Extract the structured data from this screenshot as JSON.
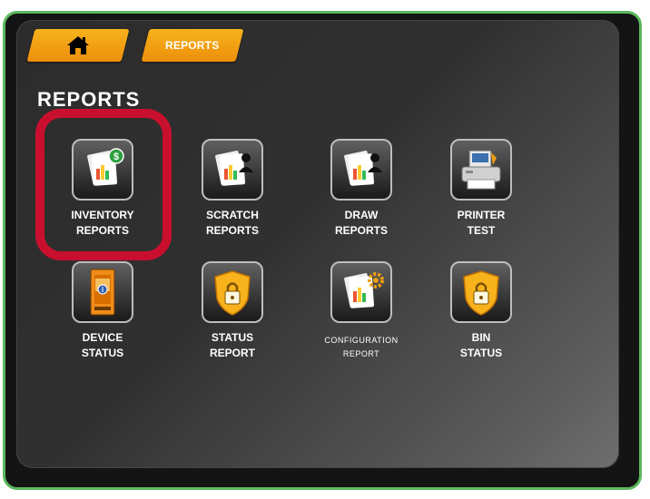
{
  "breadcrumb": {
    "home_icon": "home-icon",
    "current": "REPORTS"
  },
  "page": {
    "title": "REPORTS"
  },
  "tiles": [
    {
      "label": "INVENTORY\nREPORTS",
      "icon": "inventory-report-icon",
      "selected": true
    },
    {
      "label": "SCRATCH\nREPORTS",
      "icon": "scratch-report-icon"
    },
    {
      "label": "DRAW\nREPORTS",
      "icon": "draw-report-icon"
    },
    {
      "label": "PRINTER\nTEST",
      "icon": "printer-icon"
    },
    {
      "label": "DEVICE\nSTATUS",
      "icon": "device-icon"
    },
    {
      "label": "STATUS\nREPORT",
      "icon": "shield-lock-icon"
    },
    {
      "label": "CONFIGURATION\nREPORT",
      "icon": "configuration-report-icon"
    },
    {
      "label": "BIN\nSTATUS",
      "icon": "shield-lock-icon"
    }
  ],
  "colors": {
    "accent_tab": "#f0a010",
    "highlight": "#c8102e",
    "frame_border": "#5cb85c"
  }
}
